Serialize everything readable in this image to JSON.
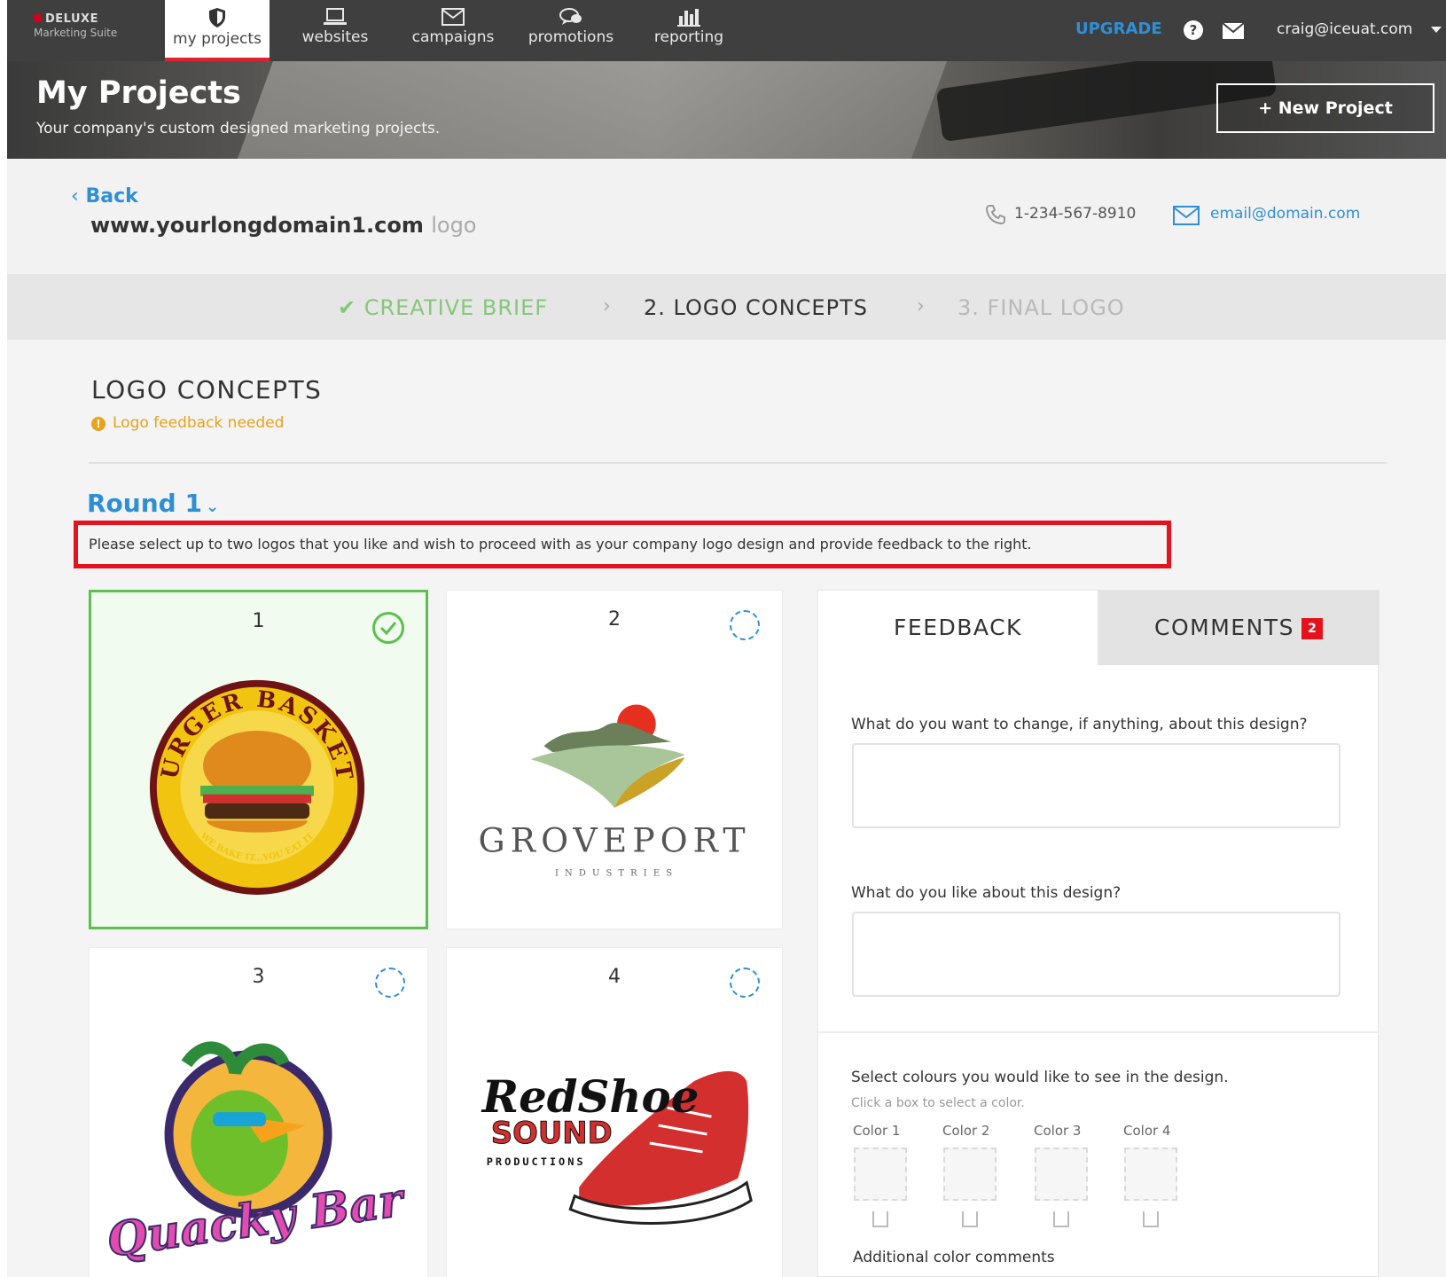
{
  "brand": {
    "name": "DELUXE",
    "suite": "Marketing Suite"
  },
  "nav": {
    "items": [
      {
        "label": "my projects",
        "icon": "shield-icon"
      },
      {
        "label": "websites",
        "icon": "laptop-icon"
      },
      {
        "label": "campaigns",
        "icon": "envelope-icon"
      },
      {
        "label": "promotions",
        "icon": "chat-icon"
      },
      {
        "label": "reporting",
        "icon": "bar-chart-icon"
      }
    ],
    "upgrade": "UPGRADE",
    "help": "?",
    "user_email": "craig@iceuat.com"
  },
  "hero": {
    "title": "My Projects",
    "subtitle": "Your company's custom designed marketing projects.",
    "new_project": "+ New Project"
  },
  "info": {
    "back": "Back",
    "domain": "www.yourlongdomain1.com",
    "domain_suffix": "logo",
    "phone": "1-234-567-8910",
    "email": "email@domain.com"
  },
  "steps": {
    "step1": "CREATIVE BRIEF",
    "step2": "2. LOGO CONCEPTS",
    "step3": "3. FINAL LOGO",
    "separator": "›"
  },
  "main": {
    "title": "LOGO CONCEPTS",
    "warning": "Logo feedback needed",
    "warning_icon": "!",
    "round": "Round 1",
    "instruction": "Please select up to two logos that you like and wish to proceed with as your company logo design and provide feedback to the right."
  },
  "logos": [
    {
      "number": "1",
      "name": "BURGER BASKETS",
      "tagline": "WE BAKE IT...YOU EAT IT",
      "selected": true
    },
    {
      "number": "2",
      "name": "GROVEPORT",
      "tagline": "I N D U S T R I E S",
      "selected": false
    },
    {
      "number": "3",
      "name": "Quacky Bar",
      "selected": false
    },
    {
      "number": "4",
      "name": "RedShoe",
      "name2": "SOUND",
      "tagline": "PRODUCTIONS",
      "selected": false
    }
  ],
  "panel": {
    "tab_feedback": "FEEDBACK",
    "tab_comments": "COMMENTS",
    "comments_count": "2",
    "q1": "What do you want to change, if anything, about this design?",
    "q2": "What do you like about this design?",
    "colors_prompt": "Select colours you would like to see in the design.",
    "colors_hint": "Click a box to select a color.",
    "colors": [
      "Color 1",
      "Color 2",
      "Color 3",
      "Color 4"
    ],
    "additional": "Additional color comments"
  },
  "colors": {
    "accent": "#2f8fd6",
    "highlight": "#e5121e",
    "success": "#5cbf4e",
    "warning": "#e8a21c",
    "nav_bg": "#3f3f3f"
  }
}
